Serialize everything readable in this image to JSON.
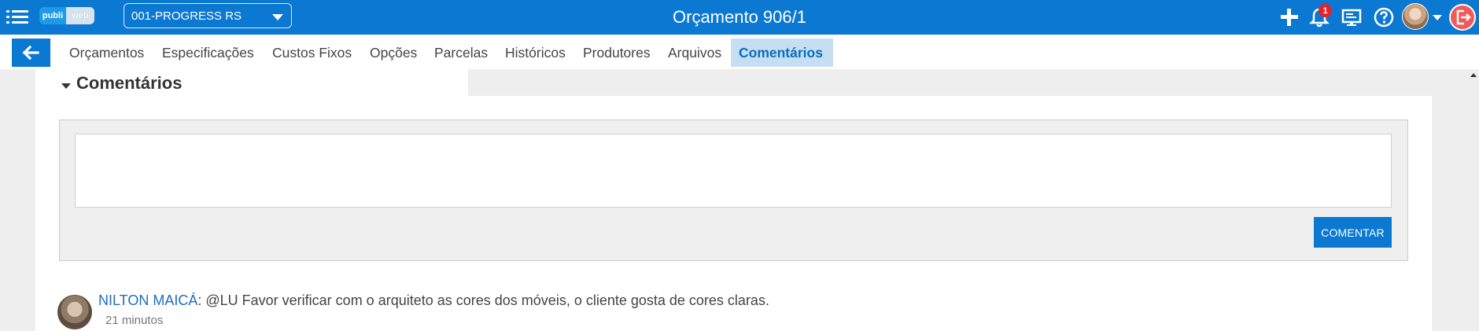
{
  "header": {
    "logo_part1": "publi",
    "logo_part2": "web",
    "company_selector": "001-PROGRESS RS",
    "title": "Orçamento 906/1",
    "notification_count": "1"
  },
  "tabs": [
    {
      "label": "Orçamentos"
    },
    {
      "label": "Especificações"
    },
    {
      "label": "Custos Fixos"
    },
    {
      "label": "Opções"
    },
    {
      "label": "Parcelas"
    },
    {
      "label": "Históricos"
    },
    {
      "label": "Produtores"
    },
    {
      "label": "Arquivos"
    },
    {
      "label": "Comentários",
      "active": true
    }
  ],
  "section": {
    "title": "Comentários"
  },
  "composer": {
    "input_value": "",
    "button_label": "COMENTAR"
  },
  "comments": [
    {
      "author": "NILTON MAICÁ",
      "separator": ":",
      "text": " @LU Favor verificar com o arquiteto as cores dos móveis, o cliente gosta de cores claras.",
      "time": "21 minutos"
    }
  ],
  "colors": {
    "primary": "#0b78d1",
    "active_tab_bg": "#c5def2",
    "badge": "#e8202a",
    "logout": "#f05a5a"
  }
}
